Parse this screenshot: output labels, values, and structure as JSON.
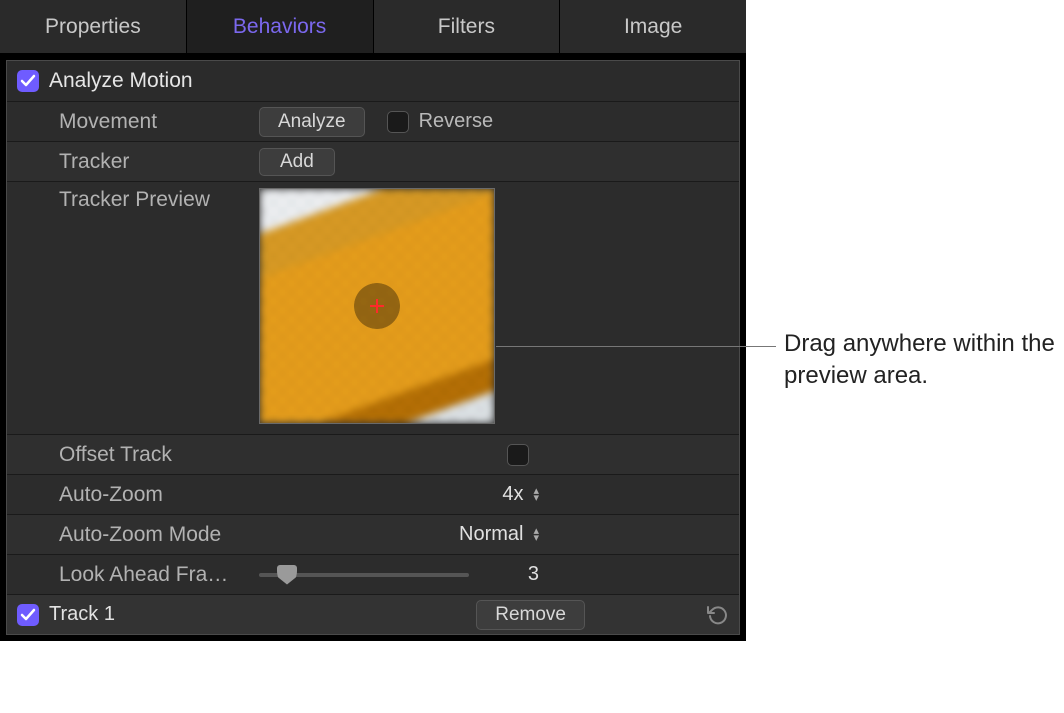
{
  "tabs": {
    "properties": "Properties",
    "behaviors": "Behaviors",
    "filters": "Filters",
    "image": "Image",
    "active": "behaviors"
  },
  "section": {
    "title": "Analyze Motion"
  },
  "rows": {
    "movement": {
      "label": "Movement",
      "btn": "Analyze",
      "reverse_label": "Reverse"
    },
    "tracker": {
      "label": "Tracker",
      "btn": "Add"
    },
    "preview": {
      "label": "Tracker Preview"
    },
    "offset": {
      "label": "Offset Track"
    },
    "autozoom": {
      "label": "Auto-Zoom",
      "value": "4x"
    },
    "autozoom_mode": {
      "label": "Auto-Zoom Mode",
      "value": "Normal"
    },
    "lookahead": {
      "label": "Look Ahead Fra…",
      "value": "3"
    }
  },
  "track": {
    "label": "Track 1",
    "btn": "Remove"
  },
  "callout": "Drag anywhere within the preview area."
}
